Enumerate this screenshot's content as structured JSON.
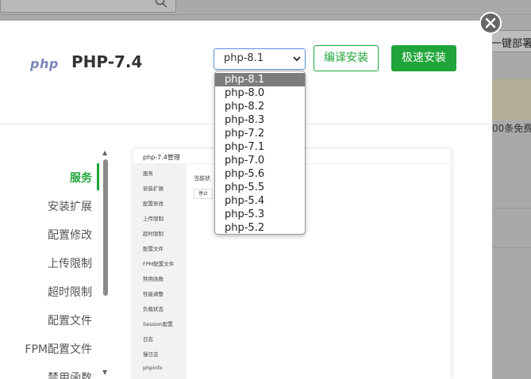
{
  "background": {
    "right_button_label": "一键部署",
    "right_banner_text": "00条免费",
    "icons": {
      "search": "search-icon"
    }
  },
  "modal": {
    "logo_text": "php",
    "title": "PHP-7.4",
    "version_select": {
      "value": "php-8.1",
      "options": [
        "php-8.1",
        "php-8.0",
        "php-8.2",
        "php-8.3",
        "php-7.2",
        "php-7.1",
        "php-7.0",
        "php-5.6",
        "php-5.5",
        "php-5.4",
        "php-5.3",
        "php-5.2"
      ]
    },
    "compile_install_label": "编译安装",
    "fast_install_label": "极速安装",
    "sidebar": {
      "items": [
        {
          "label": "服务",
          "active": true
        },
        {
          "label": "安装扩展"
        },
        {
          "label": "配置修改"
        },
        {
          "label": "上传限制"
        },
        {
          "label": "超时限制"
        },
        {
          "label": "配置文件"
        },
        {
          "label": "FPM配置文件"
        },
        {
          "label": "禁用函数"
        }
      ]
    },
    "preview": {
      "title": "php-7.4管理",
      "items": [
        "服务",
        "安装扩展",
        "配置修改",
        "上传限制",
        "超时限制",
        "配置文件",
        "FPM配置文件",
        "禁用函数",
        "性能调整",
        "负载状态",
        "Session配置",
        "日志",
        "慢日志",
        "phpinfo"
      ],
      "status_label": "当前状",
      "stop_label": "停止"
    }
  },
  "colors": {
    "accent_green": "#20a53a",
    "select_border": "#5b8fd6",
    "overlay": "#a9a9a9"
  }
}
